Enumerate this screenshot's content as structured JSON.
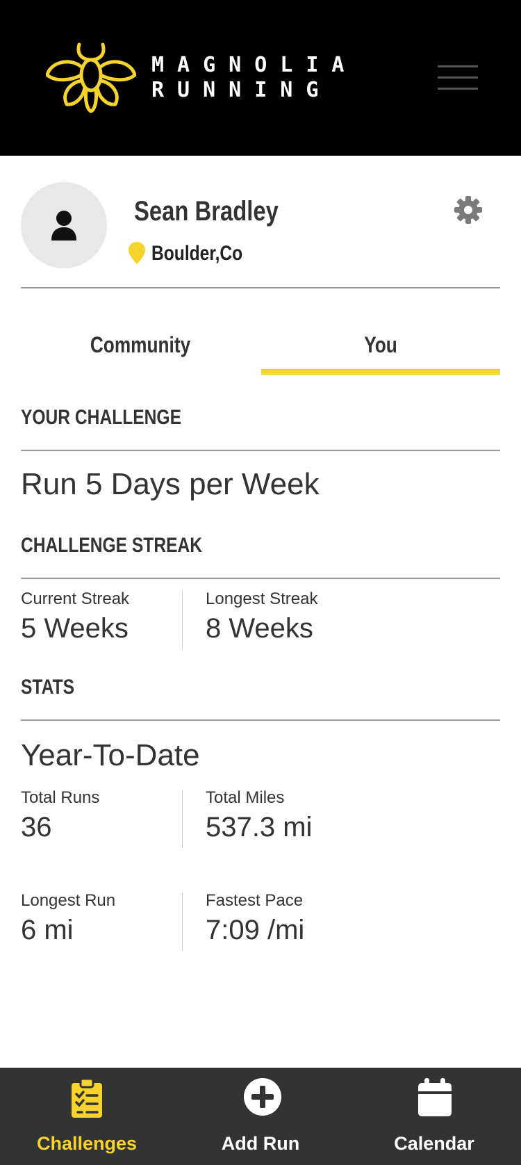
{
  "header": {
    "brand_line1": "MAGNOLIA",
    "brand_line2": "RUNNING",
    "logo_icon": "firefly-logo-icon",
    "menu_icon": "hamburger-menu-icon"
  },
  "profile": {
    "name": "Sean Bradley",
    "location": "Boulder,Co",
    "avatar_icon": "person-icon",
    "location_icon": "map-pin-icon",
    "settings_icon": "gear-icon"
  },
  "tabs": [
    {
      "label": "Community",
      "active": false
    },
    {
      "label": "You",
      "active": true
    }
  ],
  "challenge": {
    "heading": "YOUR CHALLENGE",
    "text": "Run 5 Days per Week"
  },
  "streak": {
    "heading": "CHALLENGE STREAK",
    "current_label": "Current Streak",
    "current_value": "5 Weeks",
    "longest_label": "Longest Streak",
    "longest_value": "8 Weeks"
  },
  "stats": {
    "heading": "STATS",
    "period": "Year-To-Date",
    "total_runs_label": "Total Runs",
    "total_runs_value": "36",
    "total_miles_label": "Total Miles",
    "total_miles_value": "537.3 mi",
    "longest_run_label": "Longest Run",
    "longest_run_value": "6 mi",
    "fastest_pace_label": "Fastest Pace",
    "fastest_pace_value": "7:09 /mi"
  },
  "bottom_nav": [
    {
      "label": "Challenges",
      "icon": "clipboard-checklist-icon",
      "active": true
    },
    {
      "label": "Add Run",
      "icon": "plus-circle-icon",
      "active": false
    },
    {
      "label": "Calendar",
      "icon": "calendar-icon",
      "active": false
    }
  ],
  "colors": {
    "accent": "#f7d42b",
    "header_bg": "#000000",
    "nav_bg": "#333333",
    "text": "#333333"
  }
}
